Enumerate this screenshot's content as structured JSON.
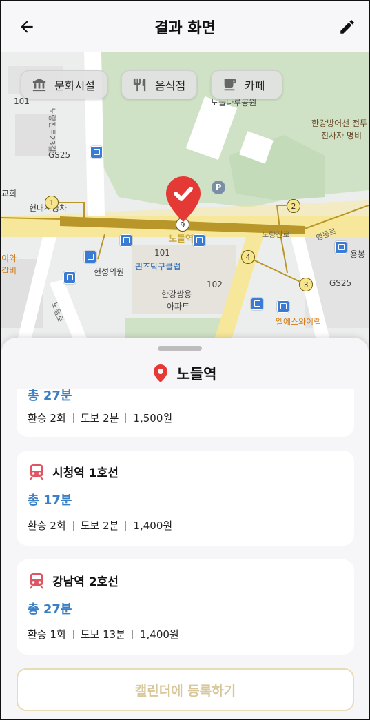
{
  "header": {
    "title": "결과 화면"
  },
  "map": {
    "chips": [
      {
        "label": "문화시설",
        "icon": "museum-icon"
      },
      {
        "label": "음식점",
        "icon": "restaurant-icon"
      },
      {
        "label": "카페",
        "icon": "cafe-icon"
      }
    ],
    "labels": {
      "n101": "101",
      "gs25_left": "GS25",
      "church": "교회",
      "hyundai": "현대자동차",
      "hyunseong": "현성의원",
      "quiz": "퀸즈탁구클럽",
      "apt_num": "101",
      "apt102": "102",
      "apt_name1": "한강쌍용",
      "apt_name2": "아파트",
      "nodeul_site": "노들나루공원",
      "hangang1": "한강방어선 전투",
      "hangang2": "전사자 명비",
      "gs25_right": "GS25",
      "yongbong": "용봉",
      "nodeul_road": "노량진로",
      "yeongdeung": "영등로",
      "es_wine": "엘에스와이랩",
      "left_wa": "이와",
      "left_galbi": "갈비",
      "station_label": "노들역",
      "road_left": "노량진로23길",
      "road_bottom": "노들로"
    },
    "stop_numbers": [
      "1",
      "2",
      "3",
      "4",
      "9"
    ]
  },
  "sheet": {
    "station_name": "노들역",
    "routes": [
      {
        "total": "총 27분",
        "transfer": "환승 2회",
        "walk": "도보 2분",
        "fare": "1,500원"
      },
      {
        "line": "시청역 1호선",
        "total": "총 17분",
        "transfer": "환승 2회",
        "walk": "도보 2분",
        "fare": "1,400원"
      },
      {
        "line": "강남역 2호선",
        "total": "총 27분",
        "transfer": "환승 1회",
        "walk": "도보 13분",
        "fare": "1,400원"
      }
    ],
    "register_label": "캘린더에 등록하기"
  },
  "colors": {
    "accent_blue": "#3b7fc4",
    "pin_red": "#e53935",
    "subway_red": "#e05561",
    "route_gold": "#b8962a"
  }
}
